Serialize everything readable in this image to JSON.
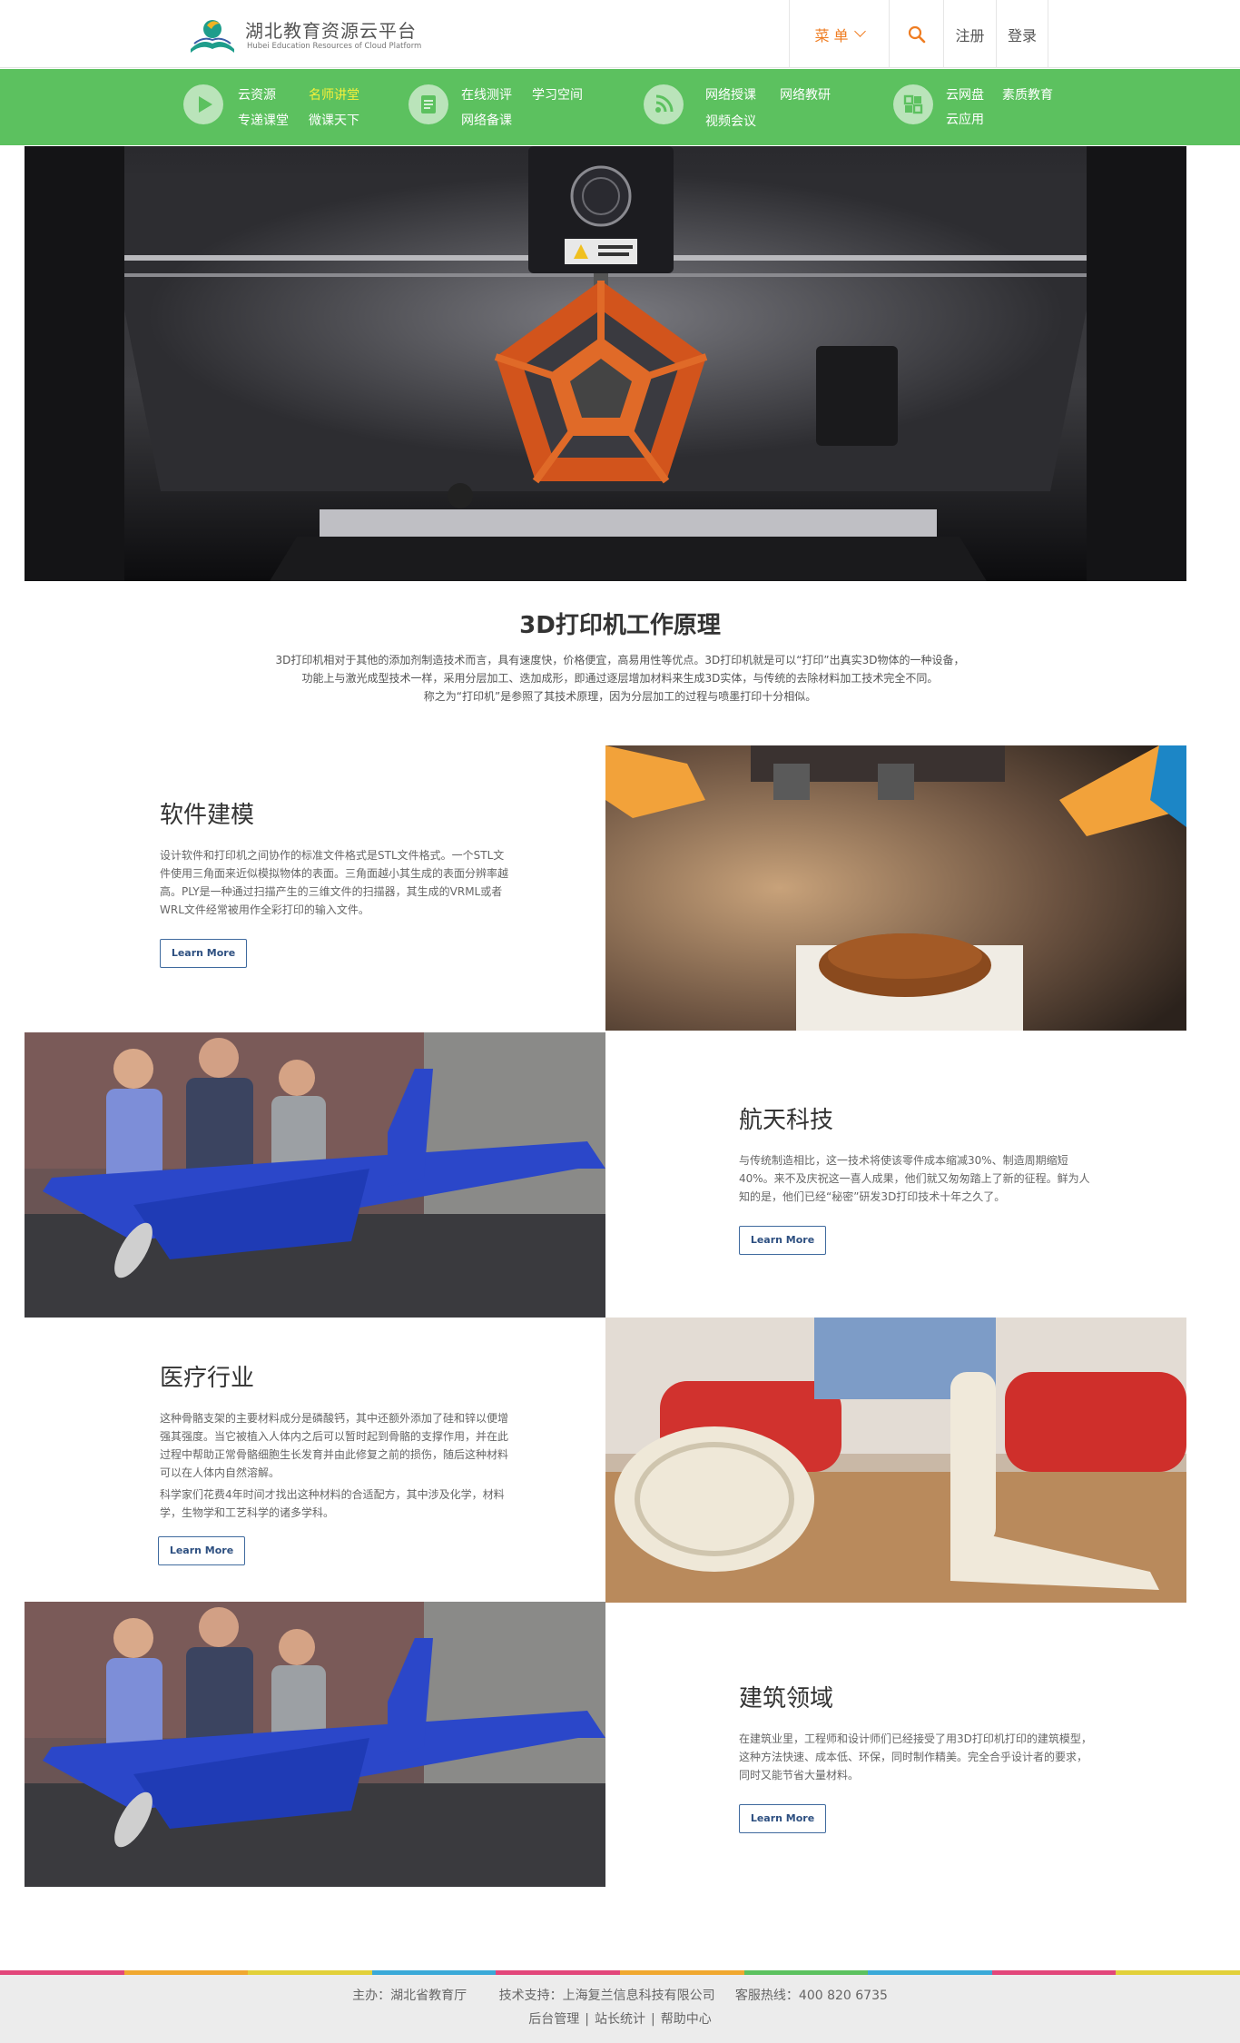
{
  "header": {
    "logo_title": "湖北教育资源云平台",
    "logo_subtitle": "Hubei Education Resources of Cloud Platform",
    "menu_label": "菜 单",
    "register_label": "注册",
    "login_label": "登录",
    "accent_color": "#ef7d22"
  },
  "greenbar": {
    "color": "#5cc15f",
    "groups": [
      {
        "icon": "play-icon",
        "links": [
          "云资源",
          "名师讲堂",
          "专递课堂",
          "微课天下"
        ]
      },
      {
        "icon": "document-icon",
        "links": [
          "在线测评",
          "学习空间",
          "网络备课"
        ]
      },
      {
        "icon": "rss-icon",
        "links": [
          "网络授课",
          "网络教研",
          "视频会议"
        ]
      },
      {
        "icon": "apps-icon",
        "links": [
          "云网盘",
          "素质教育",
          "云应用"
        ]
      }
    ]
  },
  "intro": {
    "title": "3D打印机工作原理",
    "lines": [
      "3D打印机相对于其他的添加剂制造技术而言，具有速度快，价格便宜，高易用性等优点。3D打印机就是可以“打印”出真实3D物体的一种设备，",
      "功能上与激光成型技术一样，采用分层加工、迭加成形，即通过逐层增加材料来生成3D实体，与传统的去除材料加工技术完全不同。",
      "称之为“打印机”是参照了其技术原理，因为分层加工的过程与喷墨打印十分相似。"
    ]
  },
  "features": [
    {
      "title": "软件建模",
      "paragraphs": [
        "设计软件和打印机之间协作的标准文件格式是STL文件格式。一个STL文件使用三角面来近似模拟物体的表面。三角面越小其生成的表面分辨率越高。PLY是一种通过扫描产生的三维文件的扫描器，其生成的VRML或者WRL文件经常被用作全彩打印的输入文件。"
      ],
      "button": "Learn More"
    },
    {
      "title": "航天科技",
      "paragraphs": [
        "与传统制造相比，这一技术将使该零件成本缩减30%、制造周期缩短40%。来不及庆祝这一喜人成果，他们就又匆匆踏上了新的征程。鲜为人知的是，他们已经“秘密”研发3D打印技术十年之久了。"
      ],
      "button": "Learn More"
    },
    {
      "title": "医疗行业",
      "paragraphs": [
        "这种骨骼支架的主要材料成分是磷酸钙，其中还额外添加了硅和锌以便增强其强度。当它被植入人体内之后可以暂时起到骨骼的支撑作用，并在此过程中帮助正常骨骼细胞生长发育并由此修复之前的损伤，随后这种材料可以在人体内自然溶解。",
        "科学家们花费4年时间才找出这种材料的合适配方，其中涉及化学，材料学，生物学和工艺科学的诸多学科。"
      ],
      "button": "Learn More"
    },
    {
      "title": "建筑领域",
      "paragraphs": [
        "在建筑业里，工程师和设计师们已经接受了用3D打印机打印的建筑模型，这种方法快速、成本低、环保，同时制作精美。完全合乎设计者的要求，同时又能节省大量材料。"
      ],
      "button": "Learn More"
    }
  ],
  "footer": {
    "line1": "主办：湖北省教育厅        技术支持：上海复兰信息科技有限公司     客服热线：400 820 6735",
    "links": [
      "后台管理",
      "站长统计",
      "帮助中心"
    ],
    "separator": "|"
  }
}
